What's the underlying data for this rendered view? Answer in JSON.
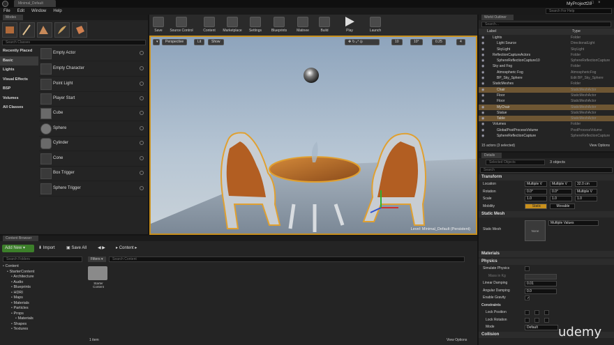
{
  "window": {
    "tab_title": "Minimal_Default",
    "project_name": "MyProject28",
    "help_placeholder": "Search For Help"
  },
  "menu": [
    "File",
    "Edit",
    "Window",
    "Help"
  ],
  "modes": {
    "title": "Modes",
    "search_placeholder": "Search Classes",
    "categories": [
      "Recently Placed",
      "Basic",
      "Lights",
      "Visual Effects",
      "BSP",
      "Volumes",
      "All Classes"
    ],
    "selected_category": "Basic",
    "items": [
      "Empty Actor",
      "Empty Character",
      "Point Light",
      "Player Start",
      "Cube",
      "Sphere",
      "Cylinder",
      "Cone",
      "Box Trigger",
      "Sphere Trigger"
    ]
  },
  "toolbar": [
    "Save",
    "Source Control",
    "Content",
    "Marketplace",
    "Settings",
    "Blueprints",
    "Matinee",
    "Build",
    "Play",
    "Launch"
  ],
  "viewport": {
    "perspective": "Perspective",
    "lit": "Lit",
    "show": "Show",
    "grid": "10",
    "rotation": "10°",
    "scale": "0.25",
    "camera_speed": "4",
    "level_label": "Level:  Minimal_Default (Persistent)"
  },
  "outliner": {
    "title": "World Outliner",
    "search_placeholder": "Search...",
    "col_label": "Label",
    "col_type": "Type",
    "rows": [
      {
        "label": "Lights",
        "type": "Folder",
        "indent": 2,
        "sel": false
      },
      {
        "label": "Light Source",
        "type": "DirectionalLight",
        "indent": 3,
        "sel": false
      },
      {
        "label": "SkyLight",
        "type": "SkyLight",
        "indent": 3,
        "sel": false
      },
      {
        "label": "ReflectionCaptureActors",
        "type": "Folder",
        "indent": 2,
        "sel": false
      },
      {
        "label": "SphereReflectionCapture10",
        "type": "SphereReflectionCapture",
        "indent": 3,
        "sel": false
      },
      {
        "label": "Sky and Fog",
        "type": "Folder",
        "indent": 2,
        "sel": false
      },
      {
        "label": "Atmospheric Fog",
        "type": "AtmosphericFog",
        "indent": 3,
        "sel": false
      },
      {
        "label": "BP_Sky_Sphere",
        "type": "Edit BP_Sky_Sphere",
        "indent": 3,
        "sel": false
      },
      {
        "label": "StaticMeshes",
        "type": "Folder",
        "indent": 2,
        "sel": false
      },
      {
        "label": "Chair",
        "type": "StaticMeshActor",
        "indent": 3,
        "sel": true
      },
      {
        "label": "Floor",
        "type": "StaticMeshActor",
        "indent": 3,
        "sel": false
      },
      {
        "label": "Floor",
        "type": "StaticMeshActor",
        "indent": 3,
        "sel": false
      },
      {
        "label": "MyChair",
        "type": "StaticMeshActor",
        "indent": 3,
        "sel": true
      },
      {
        "label": "Statue",
        "type": "StaticMeshActor",
        "indent": 3,
        "sel": false
      },
      {
        "label": "Table",
        "type": "StaticMeshActor",
        "indent": 3,
        "sel": true
      },
      {
        "label": "Volumes",
        "type": "Folder",
        "indent": 2,
        "sel": false
      },
      {
        "label": "GlobalPostProcessVolume",
        "type": "PostProcessVolume",
        "indent": 3,
        "sel": false
      },
      {
        "label": "SphereReflectionCapture",
        "type": "SphereReflectionCapture",
        "indent": 3,
        "sel": false
      }
    ],
    "footer": "15 actors (3 selected)",
    "view_options": "View Options"
  },
  "details": {
    "title": "Details",
    "selected_placeholder": "Selected Objects",
    "objects_count": "3 objects",
    "search_placeholder": "Search",
    "transform": "Transform",
    "location_label": "Location",
    "rotation_label": "Rotation",
    "scale_label": "Scale",
    "mobility_label": "Mobility",
    "location": [
      "Multiple V",
      "Multiple V",
      "32.0 cm"
    ],
    "rotation": [
      "0.0°",
      "0.0°",
      "Multiple V"
    ],
    "scale": [
      "1.0",
      "1.0",
      "1.0"
    ],
    "mobility_options": [
      "Static",
      "Movable"
    ],
    "static_mesh_section": "Static Mesh",
    "static_mesh_label": "Static Mesh",
    "static_mesh_value": "Multiple Values",
    "thumb": "None",
    "materials": "Materials",
    "physics": "Physics",
    "simulate_physics": "Simulate Physics",
    "mass_in_kg": "Mass in Kg",
    "linear_damping": "Linear Damping",
    "linear_damping_value": "0.01",
    "angular_damping": "Angular Damping",
    "angular_damping_value": "0.0",
    "enable_gravity": "Enable Gravity",
    "constraints": "Constraints",
    "lock_position": "Lock Position",
    "lock_rotation": "Lock Rotation",
    "mode": "Mode",
    "mode_value": "Default",
    "collision": "Collision"
  },
  "content_browser": {
    "title": "Content Browser",
    "add_new": "Add New",
    "import": "Import",
    "save_all": "Save All",
    "path": "Content",
    "search_folders": "Search Folders",
    "filters": "Filters",
    "search_content": "Search Content",
    "tree": [
      {
        "label": "Content",
        "indent": 0
      },
      {
        "label": "StarterContent",
        "indent": 1
      },
      {
        "label": "Architecture",
        "indent": 2
      },
      {
        "label": "Audio",
        "indent": 2
      },
      {
        "label": "Blueprints",
        "indent": 2
      },
      {
        "label": "HDRI",
        "indent": 2
      },
      {
        "label": "Maps",
        "indent": 2
      },
      {
        "label": "Materials",
        "indent": 2
      },
      {
        "label": "Particles",
        "indent": 2
      },
      {
        "label": "Props",
        "indent": 2
      },
      {
        "label": "Materials",
        "indent": 3
      },
      {
        "label": "Shapes",
        "indent": 2
      },
      {
        "label": "Textures",
        "indent": 2
      }
    ],
    "folder_label": "Starter Content",
    "item_count": "1 item",
    "view_options": "View Options"
  },
  "watermark": "udemy",
  "colors": {
    "selection": "#6e5633",
    "accent": "#c9901c",
    "bg": "#242424"
  }
}
